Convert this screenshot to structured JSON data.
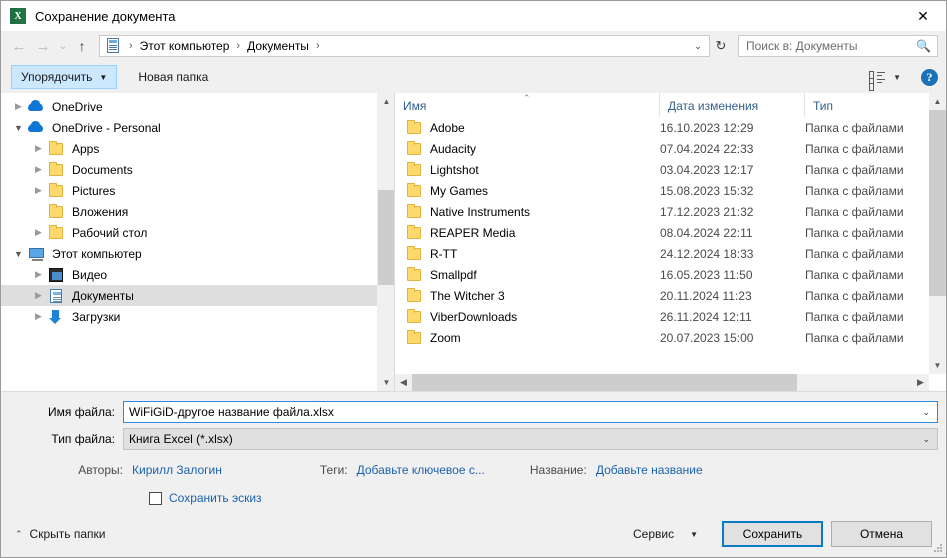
{
  "window": {
    "title": "Сохранение документа",
    "app_icon": "excel-icon",
    "close_label": "✕"
  },
  "nav": {
    "back_icon": "←",
    "forward_icon": "→",
    "history_caret": "⌄",
    "up_icon": "↑",
    "refresh_icon": "↻",
    "breadcrumb": [
      {
        "label": "Этот компьютер"
      },
      {
        "label": "Документы"
      }
    ],
    "breadcrumb_sep": "›",
    "dropdown_caret": "⌄"
  },
  "search": {
    "placeholder": "Поиск в: Документы",
    "icon": "search-icon"
  },
  "toolbar": {
    "organize_label": "Упорядочить",
    "organize_caret": "▼",
    "new_folder_label": "Новая папка",
    "view_caret": "▼",
    "help_label": "?"
  },
  "tree": {
    "items": [
      {
        "label": "OneDrive",
        "icon": "cloud-icon",
        "twisty": "›",
        "indent": 0,
        "selected": false
      },
      {
        "label": "OneDrive - Personal",
        "icon": "cloud-icon",
        "twisty": "⌄",
        "indent": 0,
        "selected": false
      },
      {
        "label": "Apps",
        "icon": "folder-icon",
        "twisty": "›",
        "indent": 1,
        "selected": false
      },
      {
        "label": "Documents",
        "icon": "folder-icon",
        "twisty": "›",
        "indent": 1,
        "selected": false
      },
      {
        "label": "Pictures",
        "icon": "folder-icon",
        "twisty": "›",
        "indent": 1,
        "selected": false
      },
      {
        "label": "Вложения",
        "icon": "folder-icon",
        "twisty": "",
        "indent": 1,
        "selected": false
      },
      {
        "label": "Рабочий стол",
        "icon": "folder-icon",
        "twisty": "›",
        "indent": 1,
        "selected": false
      },
      {
        "label": "Этот компьютер",
        "icon": "computer-icon",
        "twisty": "⌄",
        "indent": 0,
        "selected": false
      },
      {
        "label": "Видео",
        "icon": "video-icon",
        "twisty": "›",
        "indent": 1,
        "selected": false
      },
      {
        "label": "Документы",
        "icon": "documents-icon",
        "twisty": "›",
        "indent": 1,
        "selected": true
      },
      {
        "label": "Загрузки",
        "icon": "downloads-icon",
        "twisty": "›",
        "indent": 1,
        "selected": false
      }
    ]
  },
  "filelist": {
    "columns": {
      "name": "Имя",
      "date": "Дата изменения",
      "type": "Тип"
    },
    "sort_indicator": "⌃",
    "rows": [
      {
        "name": "Adobe",
        "date": "16.10.2023 12:29",
        "type": "Папка с файлами"
      },
      {
        "name": "Audacity",
        "date": "07.04.2024 22:33",
        "type": "Папка с файлами"
      },
      {
        "name": "Lightshot",
        "date": "03.04.2023 12:17",
        "type": "Папка с файлами"
      },
      {
        "name": "My Games",
        "date": "15.08.2023 15:32",
        "type": "Папка с файлами"
      },
      {
        "name": "Native Instruments",
        "date": "17.12.2023 21:32",
        "type": "Папка с файлами"
      },
      {
        "name": "REAPER Media",
        "date": "08.04.2024 22:11",
        "type": "Папка с файлами"
      },
      {
        "name": "R-TT",
        "date": "24.12.2024 18:33",
        "type": "Папка с файлами"
      },
      {
        "name": "Smallpdf",
        "date": "16.05.2023 11:50",
        "type": "Папка с файлами"
      },
      {
        "name": "The Witcher 3",
        "date": "20.11.2024 11:23",
        "type": "Папка с файлами"
      },
      {
        "name": "ViberDownloads",
        "date": "26.11.2024 12:11",
        "type": "Папка с файлами"
      },
      {
        "name": "Zoom",
        "date": "20.07.2023 15:00",
        "type": "Папка с файлами"
      }
    ]
  },
  "form": {
    "filename_label": "Имя файла:",
    "filename_value": "WiFiGiD-другое название файла.xlsx",
    "filetype_label": "Тип файла:",
    "filetype_value": "Книга Excel (*.xlsx)",
    "combo_caret": "⌄",
    "authors_label": "Авторы:",
    "authors_value": "Кирилл Залогин",
    "tags_label": "Теги:",
    "tags_value": "Добавьте ключевое с...",
    "title_label": "Название:",
    "title_value": "Добавьте название",
    "thumbnail_checkbox_label": "Сохранить эскиз",
    "thumbnail_checked": false
  },
  "footer": {
    "hide_folders_label": "Скрыть папки",
    "hide_folders_caret": "⌃",
    "tools_label": "Сервис",
    "tools_caret": "▼",
    "save_label": "Сохранить",
    "cancel_label": "Отмена"
  },
  "colors": {
    "accent": "#0a7bc0",
    "link": "#1b62ad",
    "selection": "#dedede",
    "organize_bg": "#cce8ff",
    "column_header": "#34618c"
  }
}
